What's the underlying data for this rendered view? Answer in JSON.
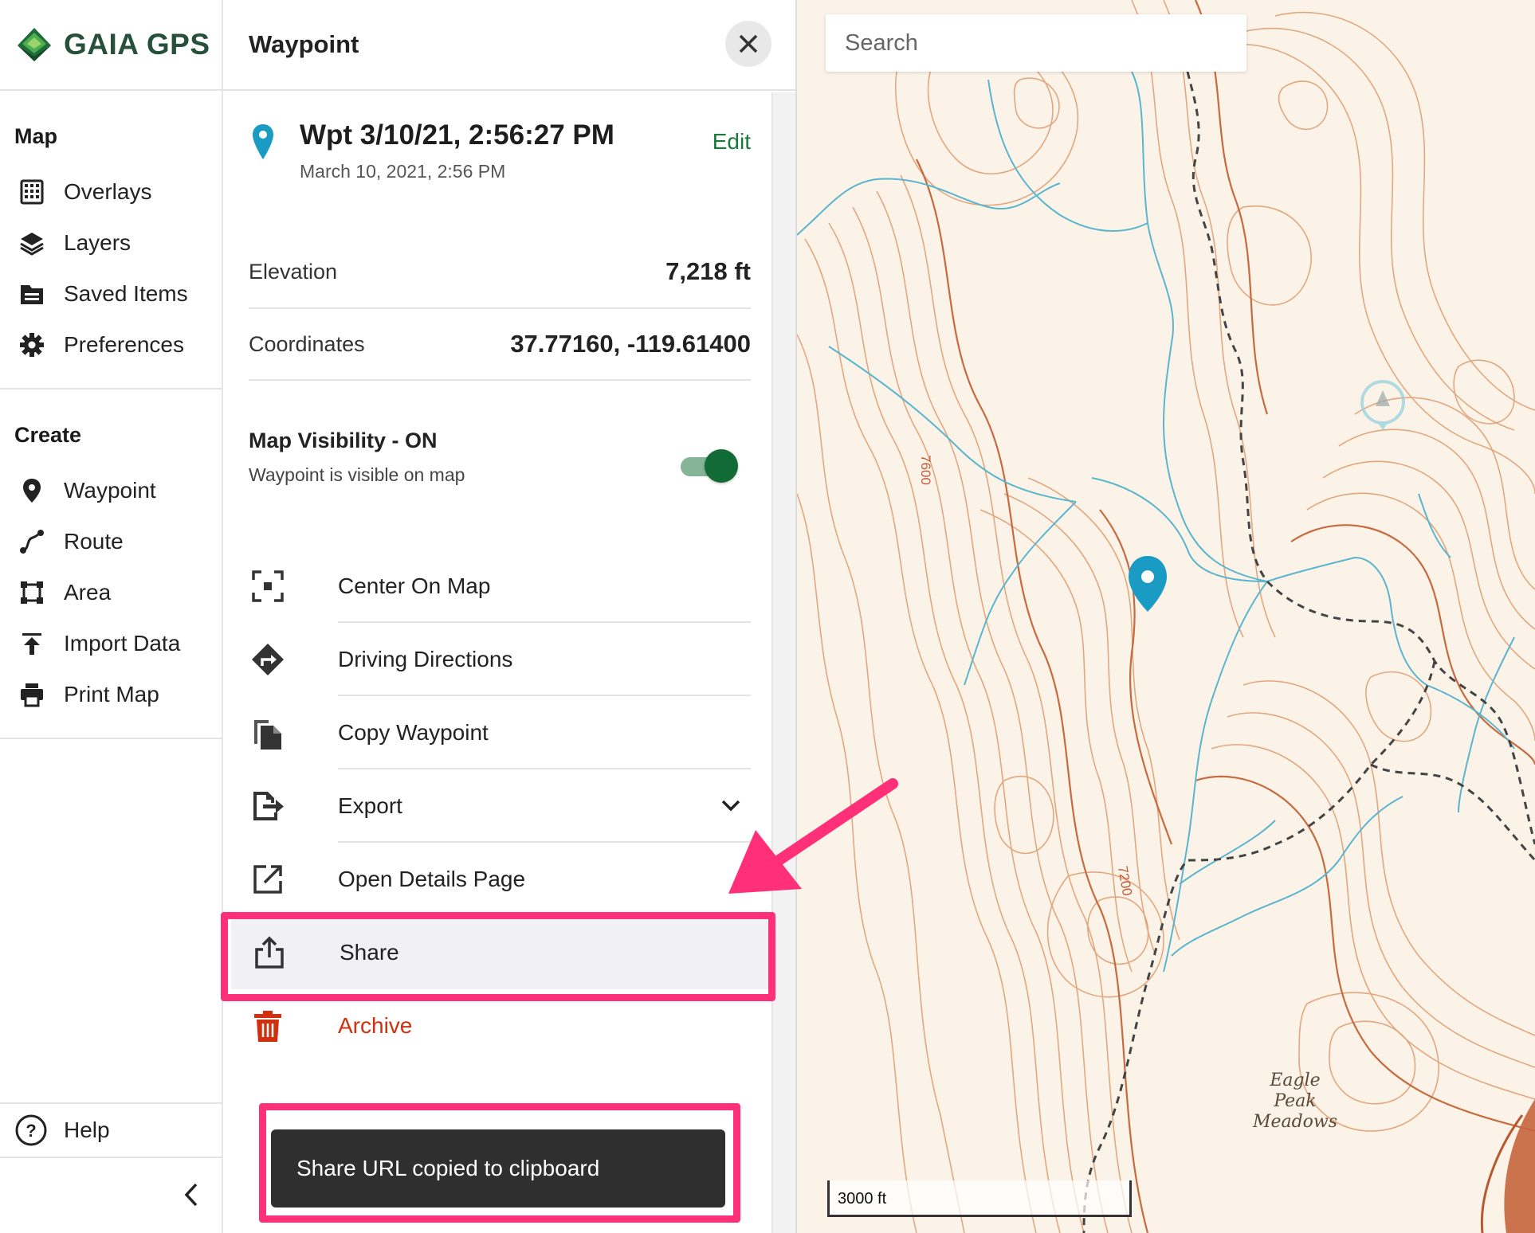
{
  "brand": {
    "name": "GAIA GPS"
  },
  "nav": {
    "map_heading": "Map",
    "map_items": [
      {
        "label": "Overlays",
        "icon": "grid-icon"
      },
      {
        "label": "Layers",
        "icon": "layers-icon"
      },
      {
        "label": "Saved Items",
        "icon": "folder-icon"
      },
      {
        "label": "Preferences",
        "icon": "gear-icon"
      }
    ],
    "create_heading": "Create",
    "create_items": [
      {
        "label": "Waypoint",
        "icon": "pin-icon"
      },
      {
        "label": "Route",
        "icon": "route-icon"
      },
      {
        "label": "Area",
        "icon": "area-icon"
      },
      {
        "label": "Import Data",
        "icon": "upload-icon"
      },
      {
        "label": "Print Map",
        "icon": "printer-icon"
      }
    ],
    "help_label": "Help"
  },
  "panel": {
    "title": "Waypoint",
    "waypoint_name": "Wpt 3/10/21, 2:56:27 PM",
    "waypoint_date": "March 10, 2021, 2:56 PM",
    "edit_label": "Edit",
    "elevation_label": "Elevation",
    "elevation_value": "7,218 ft",
    "coordinates_label": "Coordinates",
    "coordinates_value": "37.77160, -119.61400",
    "visibility_title": "Map Visibility - ON",
    "visibility_sub": "Waypoint is visible on map",
    "visibility_on": true,
    "actions": [
      {
        "label": "Center On Map",
        "icon": "center-icon"
      },
      {
        "label": "Driving Directions",
        "icon": "directions-icon"
      },
      {
        "label": "Copy Waypoint",
        "icon": "copy-icon"
      },
      {
        "label": "Export",
        "icon": "export-icon"
      },
      {
        "label": "Open Details Page",
        "icon": "external-link-icon"
      },
      {
        "label": "Share",
        "icon": "share-icon"
      },
      {
        "label": "Archive",
        "icon": "trash-icon"
      }
    ],
    "toast": "Share URL copied to clipboard"
  },
  "map": {
    "search_placeholder": "Search",
    "scale_label": "3000 ft",
    "place_label": [
      "Eagle",
      "Peak",
      "Meadows"
    ],
    "contour_labels": [
      "7600",
      "7200"
    ]
  },
  "colors": {
    "brand_green": "#27503c",
    "edit_green": "#1a7a3c",
    "archive_red": "#d1300f",
    "highlight_pink": "#ff2f78",
    "waypoint_blue": "#1a9bc4",
    "map_bg": "#fbf3e7",
    "contour": "#d98a5a",
    "stream": "#5ab5cf"
  }
}
